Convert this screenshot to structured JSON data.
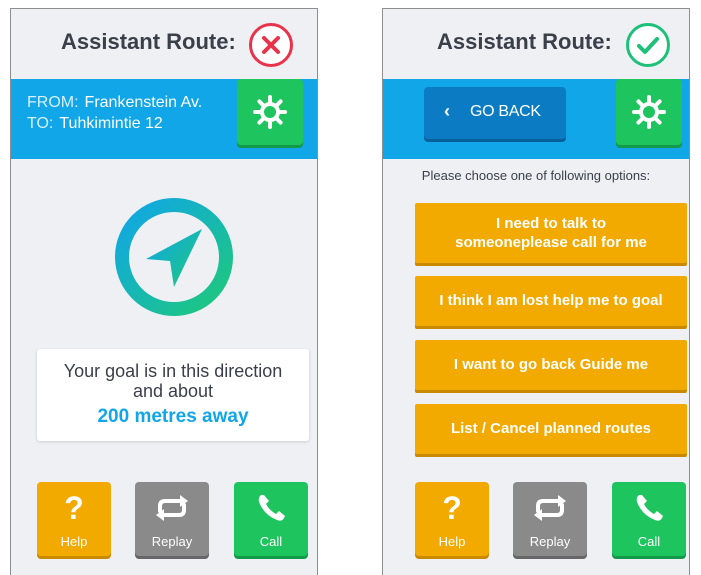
{
  "colors": {
    "accent_blue": "#10a6e8",
    "dark_blue": "#0b7cc4",
    "orange": "#f2a900",
    "green": "#1ec45e",
    "gray": "#8a8a8a",
    "error_red": "#e8334a",
    "success_green": "#1ec07a"
  },
  "left_screen": {
    "header": {
      "title": "Assistant Route:",
      "status_icon": "close-icon"
    },
    "route": {
      "from_label": "FROM:",
      "from_value": "Frankenstein Av.",
      "to_label": "TO:",
      "to_value": "Tuhkimintie 12"
    },
    "settings_icon": "gear-icon",
    "compass_icon": "navigation-arrow-icon",
    "goal": {
      "line1": "Your goal is in this direction",
      "line2": "and about",
      "distance": "200 metres away"
    },
    "actions": [
      {
        "label": "Help",
        "icon": "question-icon"
      },
      {
        "label": "Replay",
        "icon": "repeat-icon"
      },
      {
        "label": "Call",
        "icon": "phone-icon"
      }
    ]
  },
  "right_screen": {
    "header": {
      "title": "Assistant Route:",
      "status_icon": "check-icon"
    },
    "go_back": {
      "label": "GO BACK",
      "icon": "chevron-left-icon"
    },
    "settings_icon": "gear-icon",
    "prompt": "Please choose one of following options:",
    "options": [
      {
        "line1": "I need to talk to",
        "line2": "someoneplease call for me"
      },
      {
        "line1": "I think I am lost help me to goal"
      },
      {
        "line1": "I want to go back Guide me"
      },
      {
        "line1": "List / Cancel planned routes"
      }
    ],
    "actions": [
      {
        "label": "Help",
        "icon": "question-icon"
      },
      {
        "label": "Replay",
        "icon": "repeat-icon"
      },
      {
        "label": "Call",
        "icon": "phone-icon"
      }
    ]
  }
}
